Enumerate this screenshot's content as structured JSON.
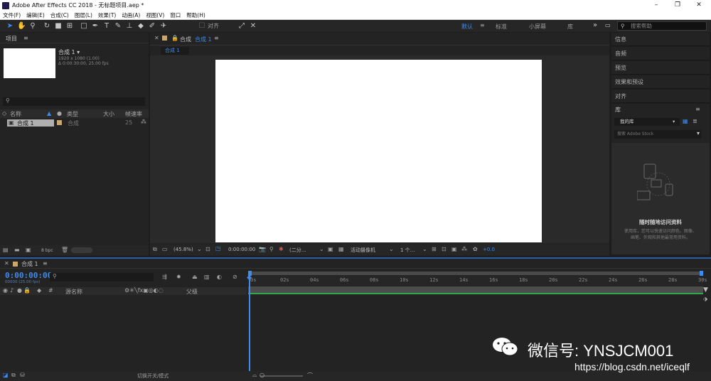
{
  "window": {
    "title": "Adobe After Effects CC 2018 - 无标题项目.aep *",
    "minimize": "–",
    "maximize": "❐",
    "close": "✕"
  },
  "menu": [
    "文件(F)",
    "编辑(E)",
    "合成(C)",
    "图层(L)",
    "效果(T)",
    "动画(A)",
    "视图(V)",
    "窗口",
    "帮助(H)"
  ],
  "toolbar": {
    "align_label": "对齐",
    "workspaces": [
      "默认",
      "标准",
      "小屏幕",
      "库"
    ],
    "more": "»",
    "search_placeholder": "搜索帮助"
  },
  "project": {
    "title": "项目",
    "comp_name": "合成 1 ▾",
    "comp_info1": "1920 x 1080 (1.00)",
    "comp_info2": "Δ 0:00:30:00, 25.00 fps",
    "columns": [
      "名称",
      "类型",
      "大小",
      "帧速率"
    ],
    "rows": [
      {
        "name": "合成 1",
        "type": "合成",
        "fps": "25"
      }
    ],
    "bpc": "8 bpc"
  },
  "composition": {
    "panel_title": "合成",
    "comp_tab_name": "合成 1",
    "subtab": "合成 1",
    "zoom": "(45.8%)",
    "timecode": "0:00:00:00",
    "resolution": "(二分…",
    "camera": "活动摄像机",
    "views": "1 个…",
    "exposure": "+0.0"
  },
  "right_panel": {
    "items": [
      "信息",
      "音频",
      "预览",
      "效果和预设",
      "对齐"
    ],
    "library": {
      "title": "库",
      "dropdown": "我的库",
      "search_placeholder": "搜索 Adobe Stock",
      "heading": "随时随地访问资料",
      "body": "使用库，您可以快速访问颜色、图像、画笔、外观和其他最常用资料。"
    }
  },
  "timeline": {
    "tab": "合成 1",
    "time": "0:00:00:00",
    "frame_info": "00000 (25.00 fps)",
    "columns": [
      "源名称",
      "父级"
    ],
    "ticks": [
      "0s",
      "02s",
      "04s",
      "06s",
      "08s",
      "10s",
      "12s",
      "14s",
      "16s",
      "18s",
      "20s",
      "22s",
      "24s",
      "26s",
      "28s",
      "30s"
    ],
    "footer": "切换开关/模式"
  },
  "watermark": {
    "wechat": "微信号: YNSJCM001",
    "url": "https://blog.csdn.net/iceqlf"
  },
  "colors": {
    "accent": "#3c8cf0",
    "panel": "#232323",
    "bg": "#1d1d1d",
    "comp_bg": "#2a2a2a",
    "green_line": "#2fa84a"
  }
}
